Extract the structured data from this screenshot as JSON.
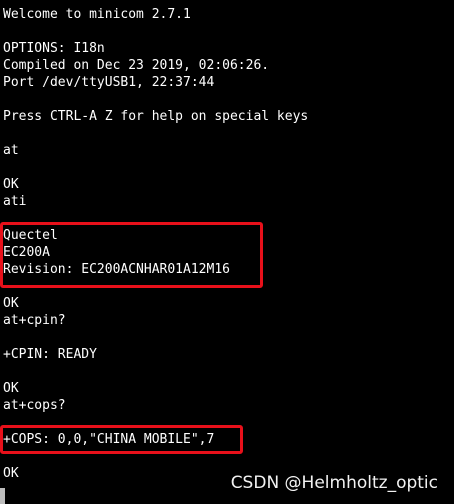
{
  "terminal": {
    "lines": [
      "Welcome to minicom 2.7.1",
      "OPTIONS: I18n",
      "Compiled on Dec 23 2019, 02:06:26.",
      "Port /dev/ttyUSB1, 22:37:44",
      "Press CTRL-A Z for help on special keys",
      "at",
      "OK",
      "ati",
      "Quectel",
      "EC200A",
      "Revision: EC200ACNHAR01A12M16",
      "OK",
      "at+cpin?",
      "+CPIN: READY",
      "OK",
      "at+cops?",
      "+COPS: 0,0,\"CHINA MOBILE\",7",
      "OK"
    ]
  },
  "watermark": "CSDN @Helmholtz_optic",
  "colors": {
    "background": "#000000",
    "text": "#ffffff",
    "highlight_border": "#e8101a"
  }
}
